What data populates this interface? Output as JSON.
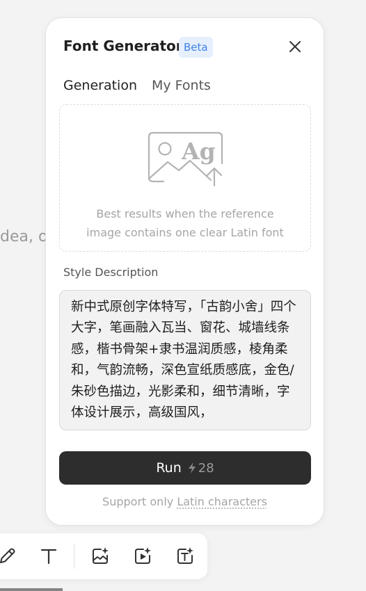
{
  "background": {
    "canvas_text": "dea, o"
  },
  "panel": {
    "title": "Font Generator",
    "badge": "Beta",
    "tabs": [
      {
        "label": "Generation",
        "active": true
      },
      {
        "label": "My Fonts",
        "active": false
      }
    ],
    "upload": {
      "icon": "image-ag-upload-icon",
      "icon_text": "Ag",
      "hint_line1": "Best results when the reference",
      "hint_line2": "image contains one clear Latin font"
    },
    "style_label": "Style Description",
    "style_value": "新中式原创字体特写，「古韵小舍」四个大字，笔画融入瓦当、窗花、城墙线条感，楷书骨架+隶书温润质感，棱角柔和，气韵流畅，深色宣纸质感底，金色/朱砂色描边，光影柔和，细节清晰，字体设计展示，高级国风，",
    "run": {
      "label": "Run",
      "cost": "28",
      "cost_icon": "bolt-icon"
    },
    "footer": {
      "prefix": "Support only ",
      "link": "Latin characters"
    }
  },
  "toolbar": {
    "tools": [
      "pen-icon",
      "text-icon",
      "image-ai-icon",
      "video-ai-icon",
      "text-ai-icon"
    ]
  },
  "colors": {
    "badge_bg": "#e5effd",
    "badge_text": "#3f82e4",
    "run_bg": "#2d2d2d",
    "muted_text": "#a5a5a5"
  }
}
